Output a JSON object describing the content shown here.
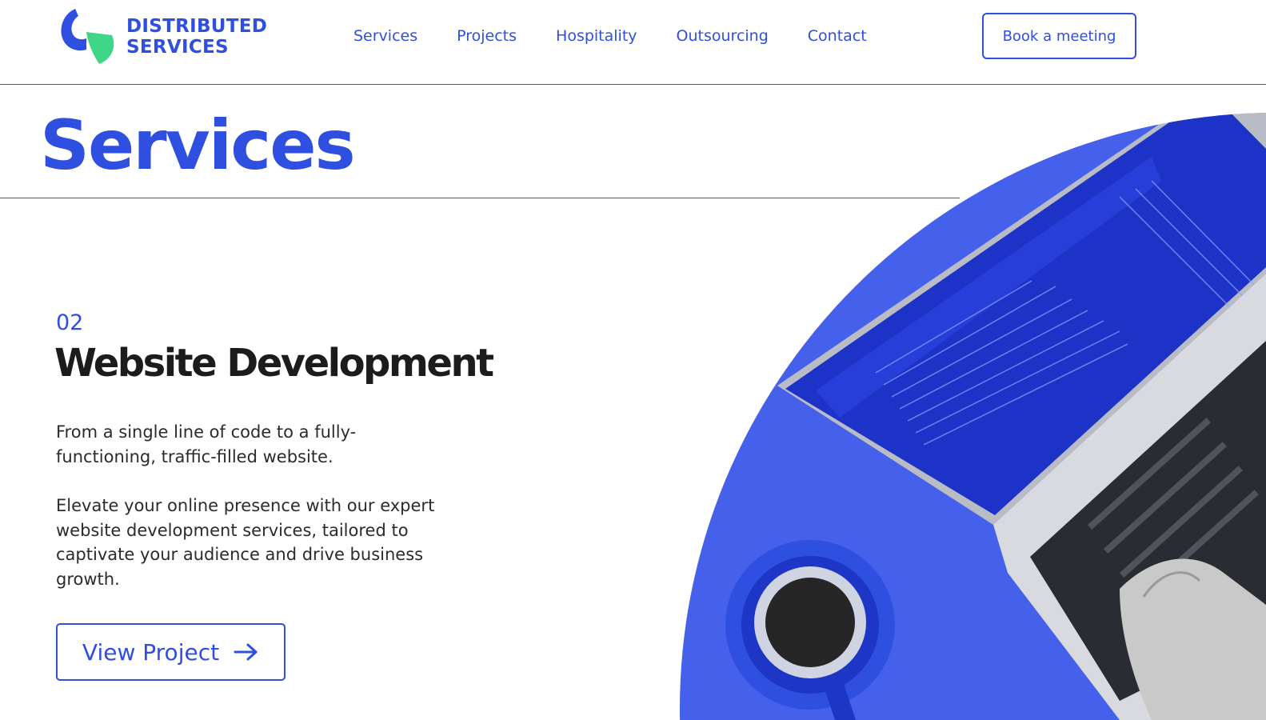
{
  "header": {
    "logo": {
      "line1": "DISTRIBUTED",
      "line2": "SERVICES"
    },
    "nav": [
      {
        "label": "Services"
      },
      {
        "label": "Projects"
      },
      {
        "label": "Hospitality"
      },
      {
        "label": "Outsourcing"
      },
      {
        "label": "Contact"
      }
    ],
    "cta_label": "Book a meeting"
  },
  "hero": {
    "title": "Services"
  },
  "service": {
    "number": "02",
    "title": "Website Development",
    "paragraph1": "From a single line of code to a fully-functioning, traffic-filled website.",
    "paragraph2": "Elevate your online presence with our expert website development services, tailored to captivate your audience and drive business growth.",
    "button_label": "View Project",
    "button_icon": "arrow-right-icon"
  },
  "colors": {
    "brand_blue": "#2f4fe0",
    "brand_green": "#3fd68a",
    "text_dark": "#1c1c1c"
  }
}
